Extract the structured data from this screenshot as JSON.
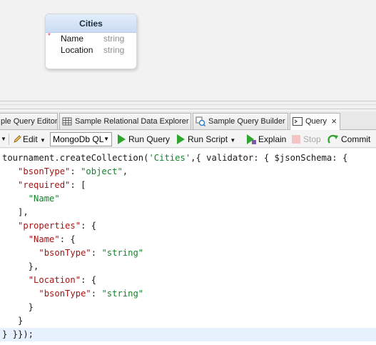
{
  "diagram": {
    "entity": {
      "title": "Cities",
      "required_marker": "*",
      "fields": [
        {
          "name": "Name",
          "type": "string",
          "required": true
        },
        {
          "name": "Location",
          "type": "string",
          "required": false
        }
      ]
    }
  },
  "tabs": [
    {
      "label": "ple Query Editor",
      "icon": "query-editor-icon",
      "active": false
    },
    {
      "label": "Sample Relational Data Explorer",
      "icon": "table-grid-icon",
      "active": false
    },
    {
      "label": "Sample Query Builder",
      "icon": "query-builder-icon",
      "active": false
    },
    {
      "label": "Query",
      "icon": "console-icon",
      "active": true,
      "close": "×"
    }
  ],
  "toolbar": {
    "edit_label": "Edit",
    "language_value": "MongoDb QL",
    "run_query_label": "Run Query",
    "run_script_label": "Run Script",
    "explain_label": "Explain",
    "stop_label": "Stop",
    "commit_label": "Commit"
  },
  "editor": {
    "lines": [
      "tournament.createCollection('Cities',{ validator: { $jsonSchema: {",
      "   \"bsonType\": \"object\",",
      "   \"required\": [",
      "     \"Name\"",
      "   ],",
      "   \"properties\": {",
      "     \"Name\": {",
      "       \"bsonType\": \"string\"",
      "     },",
      "     \"Location\": {",
      "       \"bsonType\": \"string\"",
      "     }",
      "   }",
      "} }});"
    ]
  },
  "colors": {
    "run_green": "#2fa52f",
    "string_green": "#17822d",
    "key_red": "#a31515",
    "current_line": "#e8f2fe",
    "required_red": "#dd3333"
  }
}
